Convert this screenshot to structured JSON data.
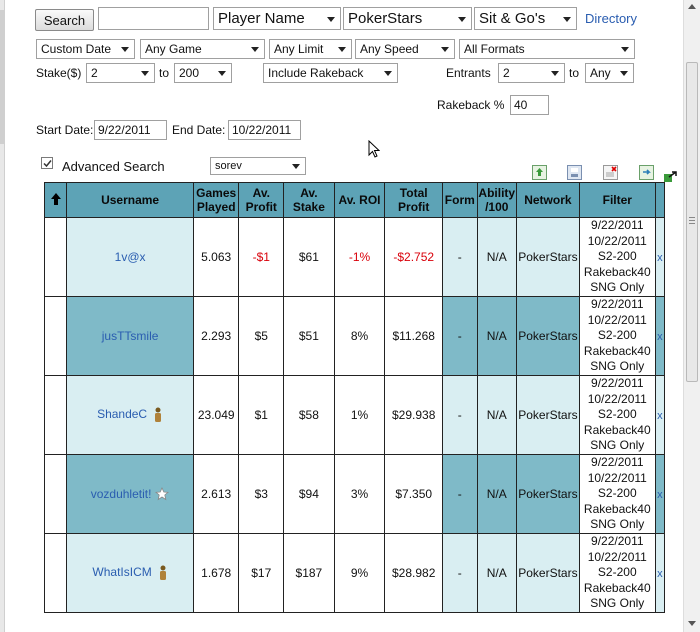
{
  "search": {
    "button_label": "Search",
    "input_value": "",
    "player_field": "Player Name",
    "site": "PokerStars",
    "game_type": "Sit & Go's",
    "directory_link": "Directory"
  },
  "filters": {
    "date_mode": "Custom Date",
    "game": "Any Game",
    "limit": "Any Limit",
    "speed": "Any Speed",
    "formats": "All Formats",
    "stake_label": "Stake($)",
    "stake_min": "2",
    "to_label": "to",
    "stake_max": "200",
    "rakeback_mode": "Include Rakeback",
    "entrants_label": "Entrants",
    "entrants_min": "2",
    "entrants_max": "Any",
    "rakeback_label": "Rakeback %",
    "rakeback_value": "40",
    "start_date_label": "Start Date:",
    "start_date": "9/22/2011",
    "end_date_label": "End Date:",
    "end_date": "10/22/2011",
    "advanced_label": "Advanced Search",
    "advanced_checked": true,
    "advanced_select": "sorev"
  },
  "toolbar": {
    "icons": [
      "spreadsheet-up-icon",
      "save-icon",
      "delete-icon",
      "refresh-icon",
      "popout-icon"
    ]
  },
  "table": {
    "headers": {
      "sort": "↑",
      "username": "Username",
      "games_played": "Games Played",
      "av_profit": "Av. Profit",
      "av_stake": "Av. Stake",
      "av_roi": "Av. ROI",
      "total_profit": "Total Profit",
      "form": "Form",
      "ability": "Ability /100",
      "network": "Network",
      "filter": "Filter"
    },
    "rows": [
      {
        "username": "1v@x",
        "badge": "",
        "games": "5.063",
        "av_profit": "-$1",
        "av_stake": "$61",
        "roi": "-1%",
        "total": "-$2.752",
        "form": "-",
        "ability": "N/A",
        "network": "PokerStars",
        "f1": "9/22/2011",
        "f2": "10/22/2011",
        "f3": "S2-200",
        "f4": "Rakeback40",
        "f5": "SNG Only",
        "remove": "x"
      },
      {
        "username": "jusTTsmile",
        "badge": "",
        "games": "2.293",
        "av_profit": "$5",
        "av_stake": "$51",
        "roi": "8%",
        "total": "$11.268",
        "form": "-",
        "ability": "N/A",
        "network": "PokerStars",
        "f1": "9/22/2011",
        "f2": "10/22/2011",
        "f3": "S2-200",
        "f4": "Rakeback40",
        "f5": "SNG Only",
        "remove": "x"
      },
      {
        "username": "ShandeC",
        "badge": "player-figure-icon",
        "games": "23.049",
        "av_profit": "$1",
        "av_stake": "$58",
        "roi": "1%",
        "total": "$29.938",
        "form": "-",
        "ability": "N/A",
        "network": "PokerStars",
        "f1": "9/22/2011",
        "f2": "10/22/2011",
        "f3": "S2-200",
        "f4": "Rakeback40",
        "f5": "SNG Only",
        "remove": "x"
      },
      {
        "username": "vozduhletit!",
        "badge": "star-badge-icon",
        "games": "2.613",
        "av_profit": "$3",
        "av_stake": "$94",
        "roi": "3%",
        "total": "$7.350",
        "form": "-",
        "ability": "N/A",
        "network": "PokerStars",
        "f1": "9/22/2011",
        "f2": "10/22/2011",
        "f3": "S2-200",
        "f4": "Rakeback40",
        "f5": "SNG Only",
        "remove": "x"
      },
      {
        "username": "WhatIsICM",
        "badge": "player-figure-icon",
        "games": "1.678",
        "av_profit": "$17",
        "av_stake": "$187",
        "roi": "9%",
        "total": "$28.982",
        "form": "-",
        "ability": "N/A",
        "network": "PokerStars",
        "f1": "9/22/2011",
        "f2": "10/22/2011",
        "f3": "S2-200",
        "f4": "Rakeback40",
        "f5": "SNG Only",
        "remove": "x"
      }
    ]
  }
}
